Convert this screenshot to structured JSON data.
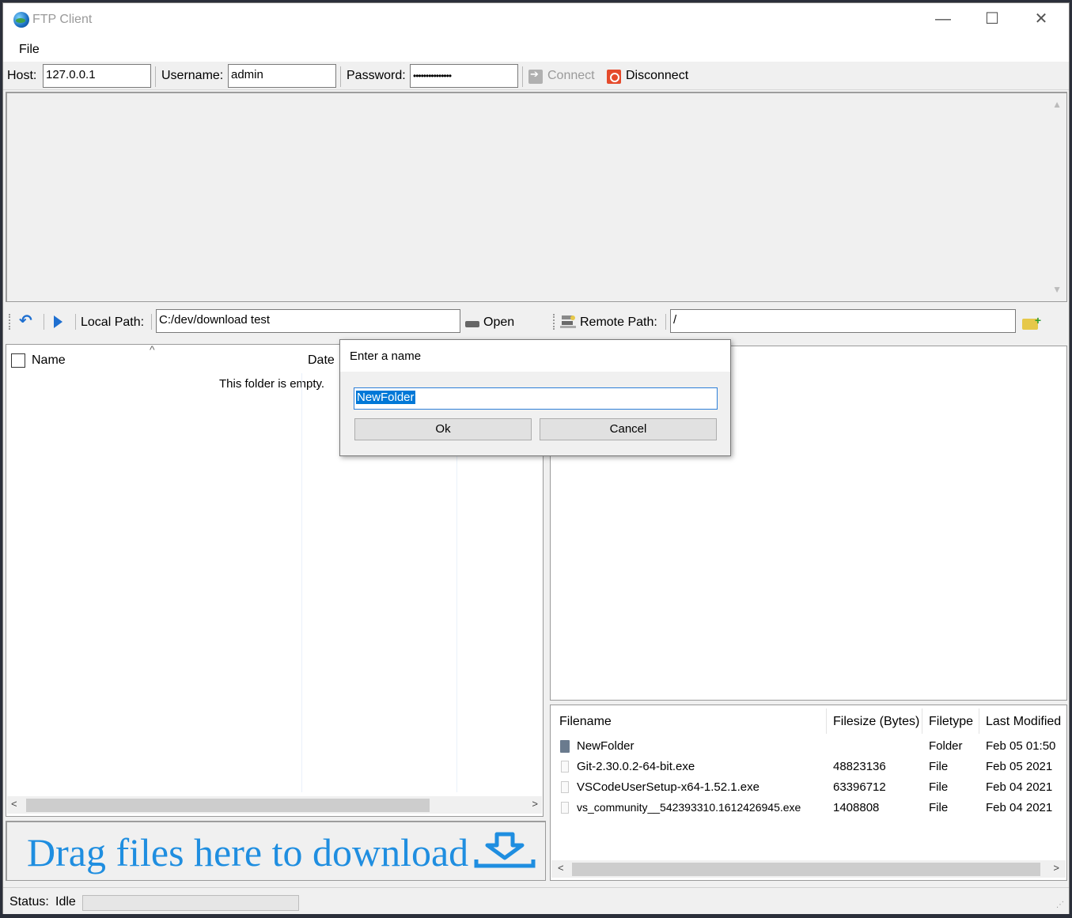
{
  "window": {
    "title": "FTP Client",
    "minimize": "—",
    "maximize": "☐",
    "close": "✕"
  },
  "menu": {
    "file": "File"
  },
  "toolbar": {
    "host_label": "Host:",
    "host_value": "127.0.0.1",
    "username_label": "Username:",
    "username_value": "admin",
    "password_label": "Password:",
    "password_value": "•••••••••••••••",
    "connect_label": "Connect",
    "disconnect_label": "Disconnect"
  },
  "local": {
    "path_label": "Local Path:",
    "path_value": "C:/dev/download test",
    "open_label": "Open",
    "columns": [
      "Name",
      "Date"
    ],
    "empty_text": "This folder is empty."
  },
  "remote": {
    "path_label": "Remote Path:",
    "path_value": "/",
    "columns": [
      "Filename",
      "Filesize (Bytes)",
      "Filetype",
      "Last Modified"
    ],
    "files": [
      {
        "name": "NewFolder",
        "size": "",
        "type": "Folder",
        "modified": "Feb 05 01:50",
        "icon": "folder-icon"
      },
      {
        "name": "Git-2.30.0.2-64-bit.exe",
        "size": "48823136",
        "type": "File",
        "modified": "Feb 05 2021",
        "icon": "file-icon"
      },
      {
        "name": "VSCodeUserSetup-x64-1.52.1.exe",
        "size": "63396712",
        "type": "File",
        "modified": "Feb 04 2021",
        "icon": "file-icon"
      },
      {
        "name": "vs_community__542393310.1612426945.exe",
        "size": "1408808",
        "type": "File",
        "modified": "Feb 04 2021",
        "icon": "file-icon"
      }
    ]
  },
  "dropzone": {
    "text": "Drag files here to download"
  },
  "status": {
    "label": "Status:",
    "value": "Idle"
  },
  "dialog": {
    "title": "Enter a name",
    "input_value": "NewFolder",
    "ok_label": "Ok",
    "cancel_label": "Cancel"
  },
  "colors": {
    "accent": "#1f8ee0",
    "selection": "#0078d7",
    "disconnect": "#e54b2c"
  }
}
